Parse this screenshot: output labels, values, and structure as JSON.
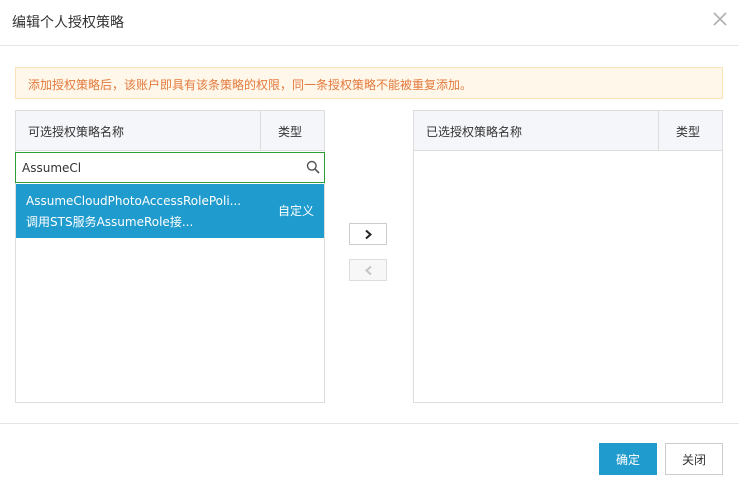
{
  "dialog": {
    "title": "编辑个人授权策略",
    "close_icon": "close-icon"
  },
  "notice": {
    "text": "添加授权策略后，该账户即具有该条策略的权限，同一条授权策略不能被重复添加。",
    "color": "#e3793c"
  },
  "left_panel": {
    "name_header": "可选授权策略名称",
    "type_header": "类型",
    "search": {
      "value": "AssumeCl",
      "placeholder": "",
      "icon": "search-icon"
    },
    "items": [
      {
        "name": "AssumeCloudPhotoAccessRolePoli...",
        "description": "调用STS服务AssumeRole接...",
        "type": "自定义",
        "selected": true
      }
    ]
  },
  "right_panel": {
    "name_header": "已选授权策略名称",
    "type_header": "类型",
    "items": []
  },
  "transfer": {
    "add_icon": "chevron-right-icon",
    "remove_icon": "chevron-left-icon"
  },
  "footer": {
    "confirm_label": "确定",
    "close_label": "关闭"
  },
  "colors": {
    "accent": "#1f9bcd",
    "search_border": "#2a9d3a",
    "notice_bg": "#fff8ea"
  }
}
